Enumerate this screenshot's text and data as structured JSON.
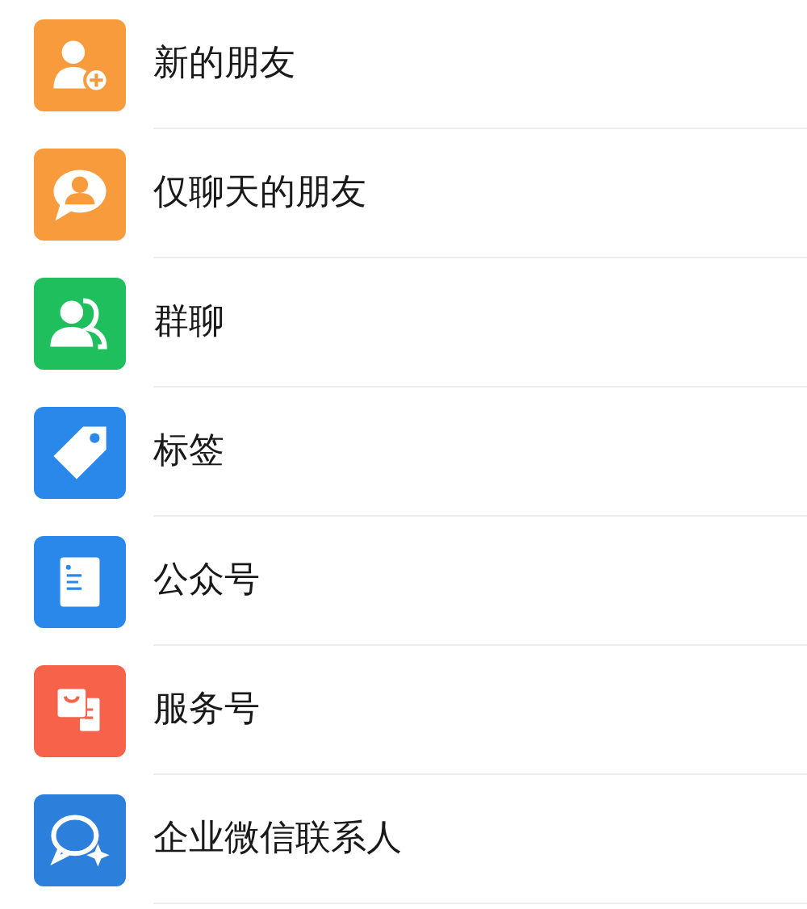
{
  "items": [
    {
      "kind": "new_friend",
      "color": "#f89b3c",
      "label": "新的朋友"
    },
    {
      "kind": "chat_only",
      "color": "#f89b3c",
      "label": "仅聊天的朋友"
    },
    {
      "kind": "group",
      "color": "#20bf5d",
      "label": "群聊"
    },
    {
      "kind": "tag",
      "color": "#2a88ea",
      "label": "标签"
    },
    {
      "kind": "official",
      "color": "#2a88ea",
      "label": "公众号"
    },
    {
      "kind": "service",
      "color": "#f6624a",
      "label": "服务号"
    },
    {
      "kind": "enterprise",
      "color": "#2d7fdc",
      "label": "企业微信联系人"
    }
  ]
}
